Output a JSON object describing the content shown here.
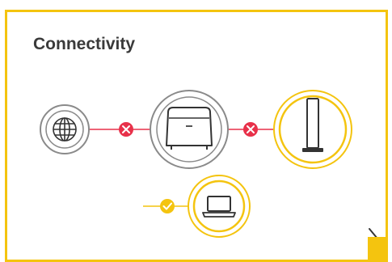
{
  "card": {
    "title": "Connectivity"
  },
  "status": {
    "internet_to_router": "disconnected",
    "router_to_extender": "disconnected",
    "extender_to_laptop": "connected"
  },
  "icons": {
    "internet": "globe-icon",
    "router": "router-icon",
    "extender": "extender-icon",
    "client": "laptop-icon",
    "next": "chevron-right-icon"
  },
  "colors": {
    "accent": "#f4c40f",
    "error": "#e8314a",
    "ring_gray": "#8a8a8a",
    "title": "#3a3a3a"
  }
}
